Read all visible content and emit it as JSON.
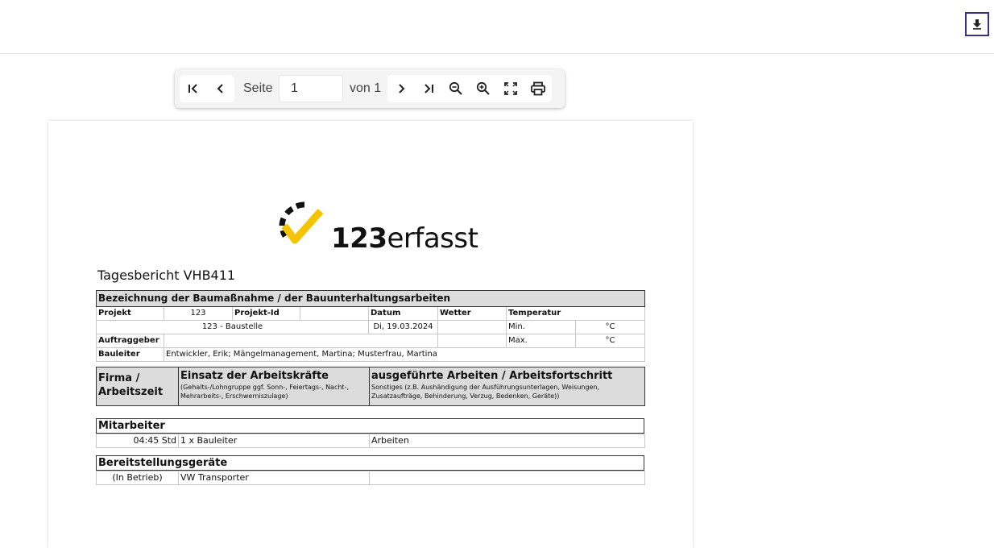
{
  "header": {
    "download_label": ""
  },
  "toolbar": {
    "page_label": "Seite",
    "page_value": "1",
    "of_label": "von 1"
  },
  "report": {
    "logo": {
      "number": "123",
      "word": "erfasst"
    },
    "title": "Tagesbericht VHB411",
    "section_title": "Bezeichnung der Baumaßnahme / der Bauunterhaltungsarbeiten",
    "projekt_label": "Projekt",
    "projekt_value": "123",
    "projekt_id_label": "Projekt-Id",
    "datum_label": "Datum",
    "wetter_label": "Wetter",
    "temperatur_label": "Temperatur",
    "projekt_name": "123 - Baustelle",
    "date": "Di, 19.03.2024",
    "min_label": "Min.",
    "max_label": "Max.",
    "unit_c": "°C",
    "auftraggeber_label": "Auftraggeber",
    "bauleiter_label": "Bauleiter",
    "bauleiter_value": "Entwickler, Erik; Mängelmanagement, Martina; Musterfrau, Martina",
    "firma_label_1": "Firma /",
    "firma_label_2": "Arbeitszeit",
    "einsatz_title": "Einsatz der Arbeitskräfte",
    "einsatz_sub_1": "(Gehalts-/Lohngruppe ggf. Sonn-, Feiertags-, Nacht-,",
    "einsatz_sub_2": "Mehrarbeits-, Erschwerniszulage)",
    "arbeiten_title": "ausgeführte Arbeiten / Arbeitsfortschritt",
    "arbeiten_sub_1": "Sonstiges (z.B. Aushändigung der Ausführungsunterlagen, Weisungen,",
    "arbeiten_sub_2": "Zusatzaufträge, Behinderung, Verzug, Bedenken, Geräte))",
    "mitarbeiter_title": "Mitarbeiter",
    "mitarbeiter_rows": [
      {
        "time": "04:45 Std",
        "count": "1 x Bauleiter",
        "work": "Arbeiten"
      }
    ],
    "geraete_title": "Bereitstellungsgeräte",
    "geraete_rows": [
      {
        "status": "(In Betrieb)",
        "name": "VW Transporter",
        "note": ""
      }
    ]
  },
  "icons": {
    "download": "download-icon",
    "first": "first-page-icon",
    "prev": "chevron-left-icon",
    "next": "chevron-right-icon",
    "last": "last-page-icon",
    "zoom_out": "zoom-out-icon",
    "zoom_in": "zoom-in-icon",
    "fullscreen": "fullscreen-icon",
    "print": "print-icon"
  },
  "colors": {
    "download_border": "#3b2e86",
    "logo_yellow": "#f5c400",
    "table_header_grey": "#dcdcdc"
  }
}
